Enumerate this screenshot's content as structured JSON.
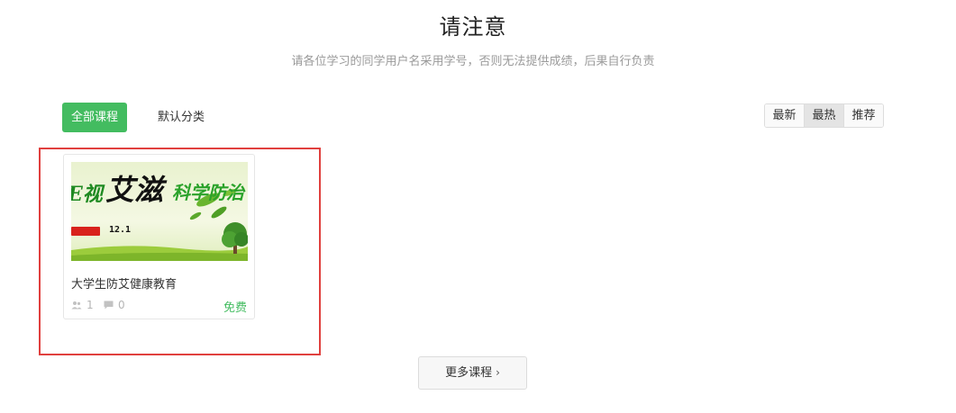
{
  "header": {
    "title": "请注意",
    "subtitle": "请各位学习的同学用户名采用学号，否则无法提供成绩，后果自行负责"
  },
  "categories": {
    "all_label": "全部课程",
    "default_label": "默认分类"
  },
  "sort": {
    "items": [
      "最新",
      "最热",
      "推荐"
    ],
    "active": "最热"
  },
  "courses": [
    {
      "title": "大学生防艾健康教育",
      "students": "1",
      "comments": "0",
      "price": "免费",
      "thumbnail": {
        "text_left": "E视",
        "text_brush": "艾滋",
        "text_right": "科学防治",
        "date": "12.1"
      }
    }
  ],
  "more_button": {
    "label": "更多课程",
    "chevron": "›"
  },
  "colors": {
    "accent_green": "#43bc60",
    "highlight_red": "#e0403e",
    "active_sort_bg": "#e4e4e4"
  },
  "icons": {
    "students": "users-icon",
    "comments": "comment-icon",
    "more": "chevron-right-icon"
  }
}
